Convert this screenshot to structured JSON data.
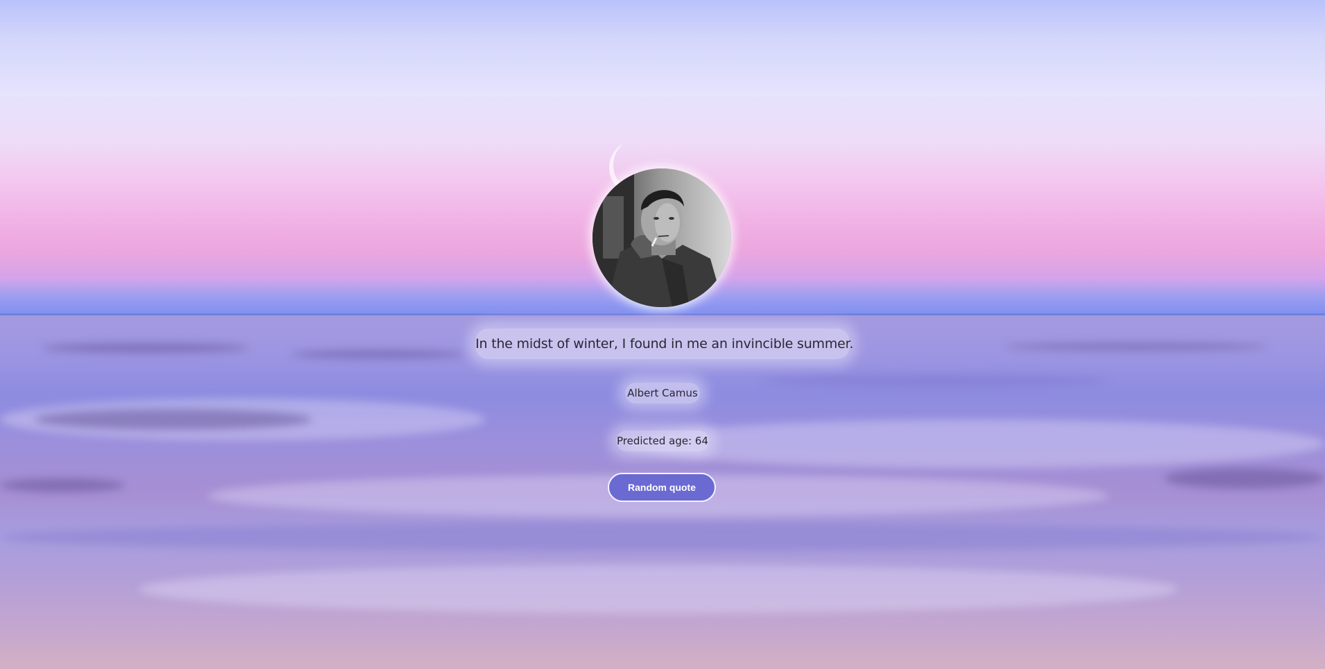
{
  "quote": {
    "text": "In the midst of winter, I found in me an invincible summer.",
    "author": "Albert Camus",
    "predicted_age_text": "Predicted age: 64"
  },
  "controls": {
    "random_quote_label": "Random quote"
  },
  "colors": {
    "button_bg": "#6b6ad3",
    "button_border": "#f4f2ff",
    "text": "#2a2733"
  }
}
